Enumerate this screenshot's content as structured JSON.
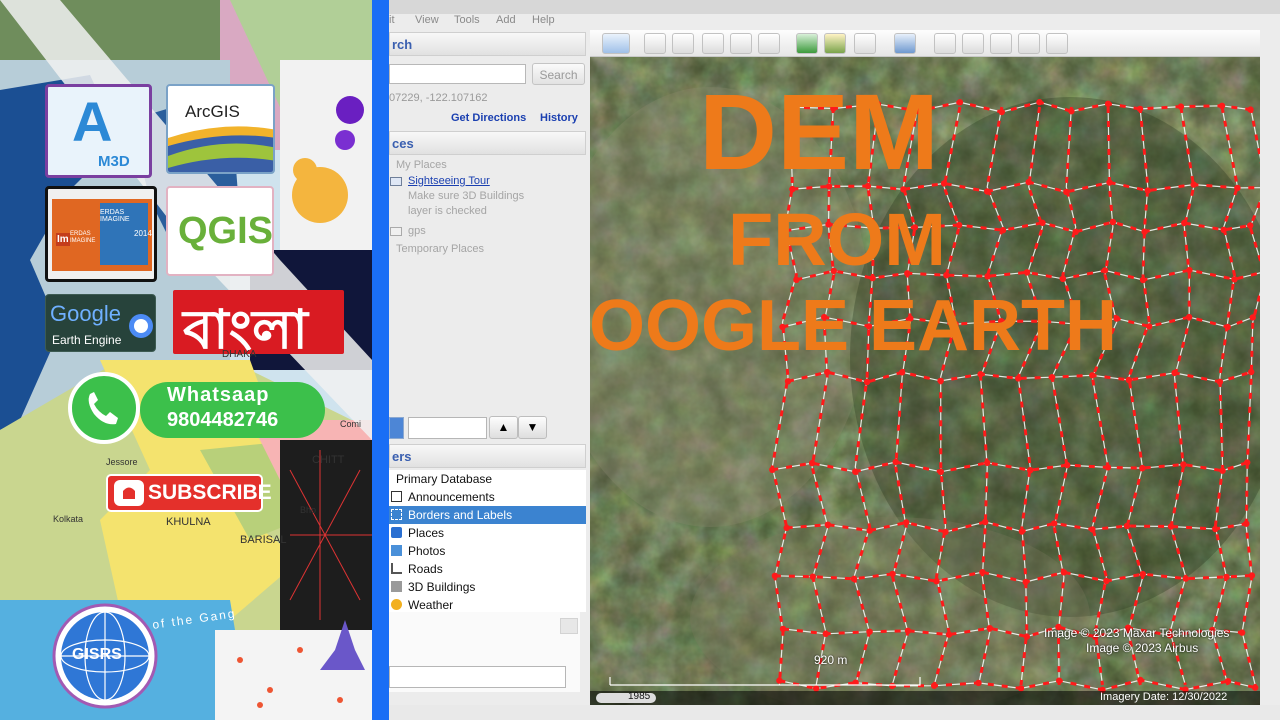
{
  "collage": {
    "logos": {
      "autodesk": {
        "letter": "A",
        "sub": "M3D"
      },
      "arcgis": {
        "text": "ArcGIS"
      },
      "erdas": {
        "brand": "ERDAS IMAGINE",
        "version": "2014",
        "mark": "Im",
        "mark_text": "ERDAS IMAGINE"
      },
      "qgis": {
        "text": "QGIS"
      },
      "gee": {
        "line1": "Google",
        "line2": "Earth Engine"
      },
      "bangla": {
        "text": "বাংলা"
      },
      "gisrs": {
        "text": "GISRS"
      }
    },
    "whatsapp": {
      "label": "Whatsaap",
      "number": "9804482746"
    },
    "subscribe": {
      "label": "SUBSCRIBE"
    },
    "map_labels": {
      "dhaka": "DHAKA",
      "jessore": "Jessore",
      "kolkata": "Kolkata",
      "khulna": "KHULNA",
      "barisal": "BARISAL",
      "chitt": "CHITT",
      "comi": "Comi",
      "ganges": "of the Gang",
      "bho": "Bho"
    }
  },
  "ge": {
    "menu": [
      "it",
      "View",
      "Tools",
      "Add",
      "Help"
    ],
    "search": {
      "header": "rch",
      "button": "Search",
      "coords": "07229, -122.107162",
      "get_directions": "Get Directions",
      "history": "History"
    },
    "places": {
      "header": "ces",
      "items": [
        {
          "label": "My Places",
          "style": "muted"
        },
        {
          "label": "Sightseeing Tour",
          "style": "link"
        },
        {
          "label": "Make sure 3D Buildings",
          "style": "muted"
        },
        {
          "label": "layer is checked",
          "style": "muted"
        },
        {
          "label": "gps",
          "style": "muted"
        },
        {
          "label": "Temporary Places",
          "style": "muted"
        }
      ]
    },
    "layers": {
      "header": "ers",
      "items": [
        {
          "label": "Primary Database",
          "selected": false
        },
        {
          "label": "Announcements",
          "selected": false
        },
        {
          "label": "Borders and Labels",
          "selected": true
        },
        {
          "label": "Places",
          "selected": false
        },
        {
          "label": "Photos",
          "selected": false
        },
        {
          "label": "Roads",
          "selected": false
        },
        {
          "label": "3D Buildings",
          "selected": false
        },
        {
          "label": "Weather",
          "selected": false
        }
      ]
    },
    "map": {
      "title1": "DEM",
      "title2": "FROM",
      "title3": "GOOGLE EARTH",
      "credit1": "Image © 2023 Maxar Technologies",
      "credit2": "Image © 2023 Airbus",
      "scale": "920 m",
      "year": "1985",
      "imagery_date": "Imagery Date: 12/30/2022"
    },
    "colors": {
      "title": "#ee7a1a",
      "grid": "#ff1a1a",
      "selection": "#3b83d0",
      "link": "#1a3fb0"
    }
  }
}
